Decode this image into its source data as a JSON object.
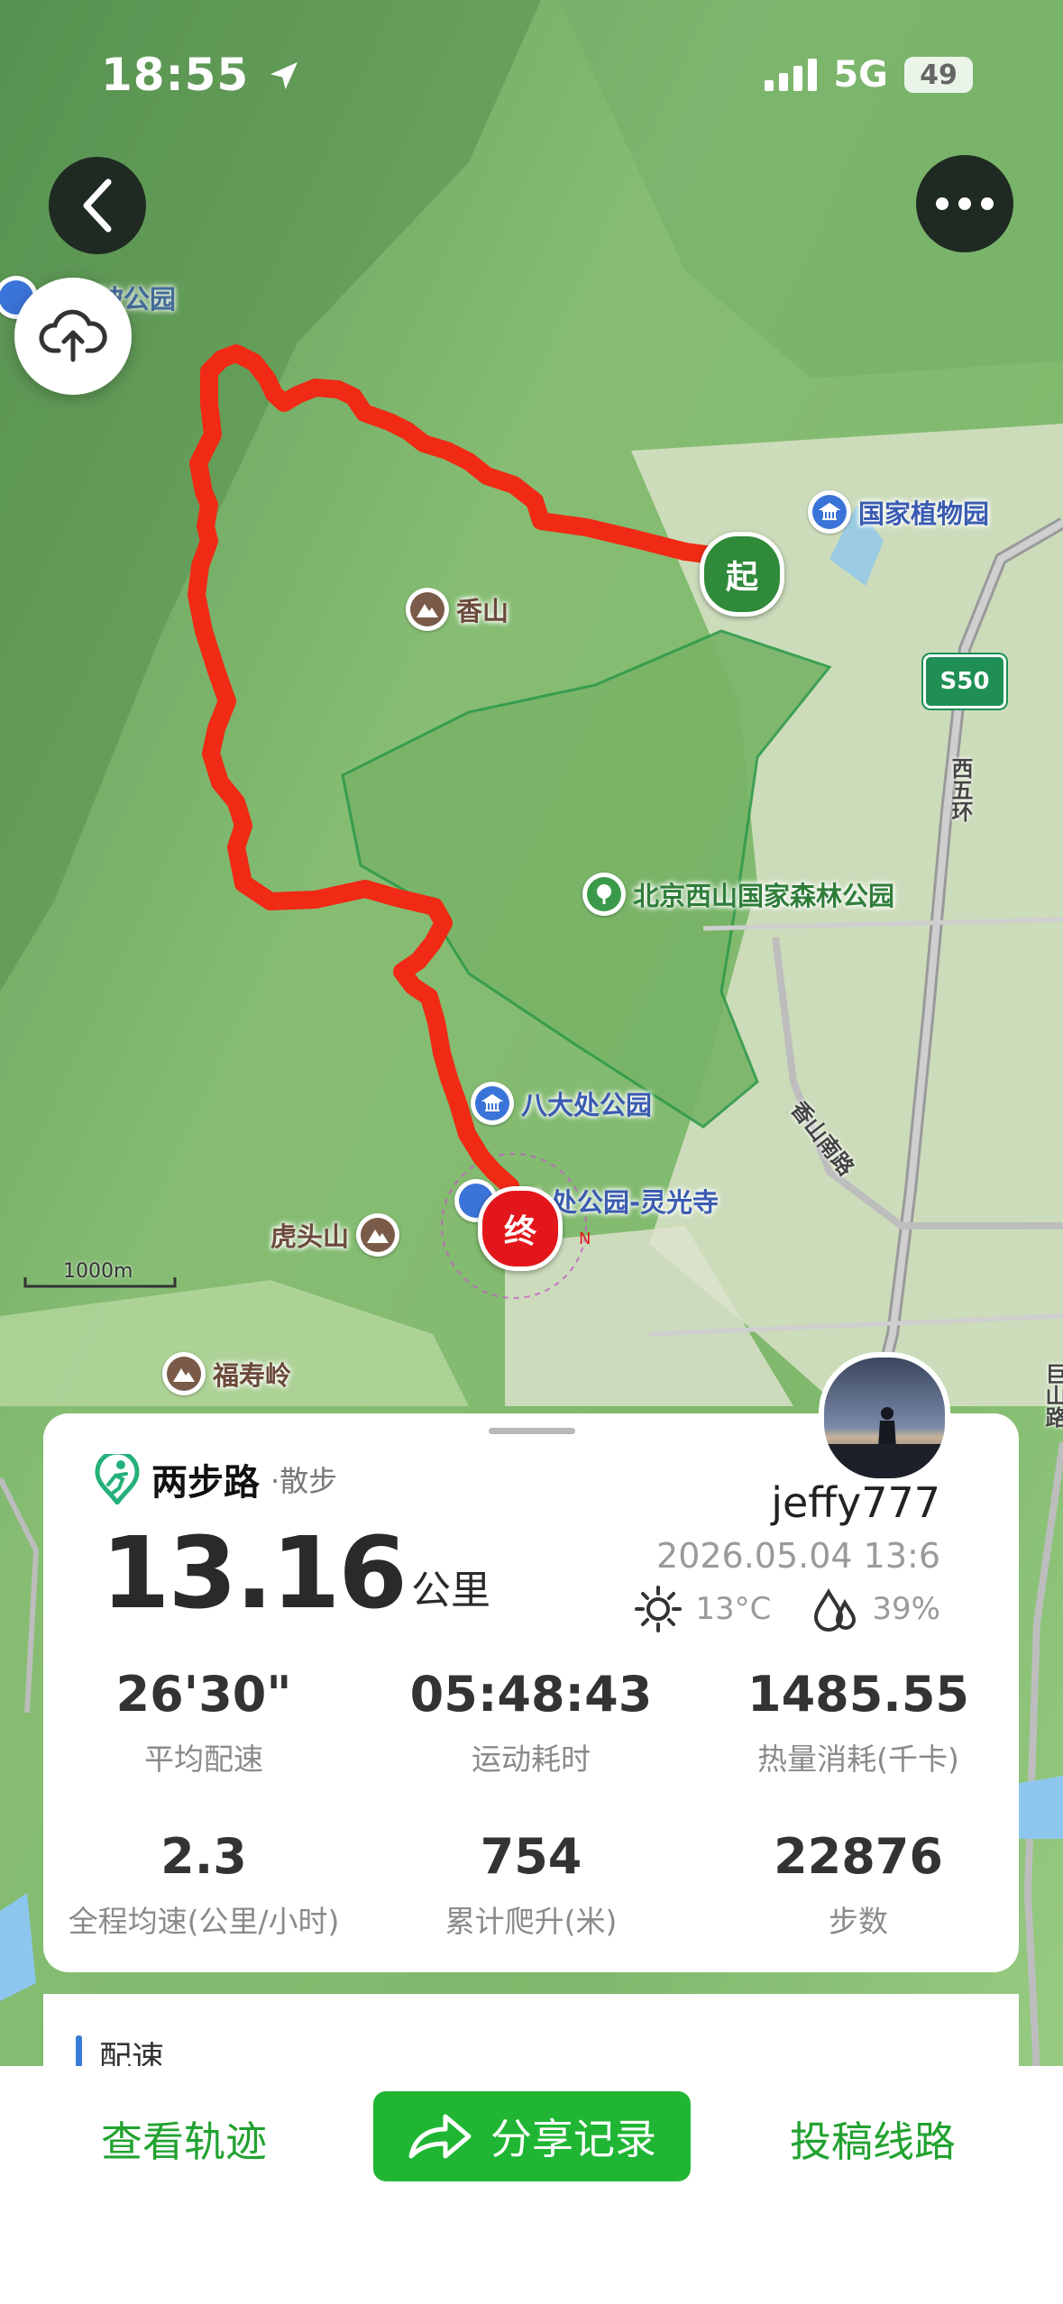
{
  "status_bar": {
    "time": "18:55",
    "network": "5G",
    "battery": "49"
  },
  "map": {
    "pois": [
      {
        "name": "国家植物园",
        "icon": "museum-icon"
      },
      {
        "name": "香山",
        "icon": "mountain-icon"
      },
      {
        "name": "北京西山国家森林公园",
        "icon": "tree-icon"
      },
      {
        "name": "八大处公园",
        "icon": "museum-icon"
      },
      {
        "name": "大处公园-灵光寺",
        "icon": "museum-icon"
      },
      {
        "name": "虎头山",
        "icon": "mountain-icon"
      },
      {
        "name": "福寿岭",
        "icon": "mountain-icon"
      },
      {
        "name": "东山坡公园",
        "icon": "museum-icon"
      }
    ],
    "roads": [
      "西五环",
      "香山南路",
      "巨山路"
    ],
    "highway_badge": "S50",
    "start_marker": "起",
    "end_marker": "终",
    "scale": "1000m"
  },
  "summary": {
    "brand": "两步路",
    "activity": "·散步",
    "distance": "13.16",
    "distance_unit": "公里",
    "username": "jeffy777",
    "datetime": "2026.05.04 13:6",
    "temperature": "13°C",
    "humidity": "39%",
    "stats": [
      {
        "value": "26'30\"",
        "label": "平均配速"
      },
      {
        "value": "05:48:43",
        "label": "运动耗时"
      },
      {
        "value": "1485.55",
        "label": "热量消耗(千卡)"
      },
      {
        "value": "2.3",
        "label": "全程均速(公里/小时)"
      },
      {
        "value": "754",
        "label": "累计爬升(米)"
      },
      {
        "value": "22876",
        "label": "步数"
      }
    ],
    "pace_section_title": "配速"
  },
  "bottom_bar": {
    "view_track": "查看轨迹",
    "share": "分享记录",
    "submit_route": "投稿线路"
  },
  "colors": {
    "route": "#f02a14",
    "accent": "#20b634",
    "start_marker": "#2f8a3a",
    "end_marker": "#e3161b"
  }
}
